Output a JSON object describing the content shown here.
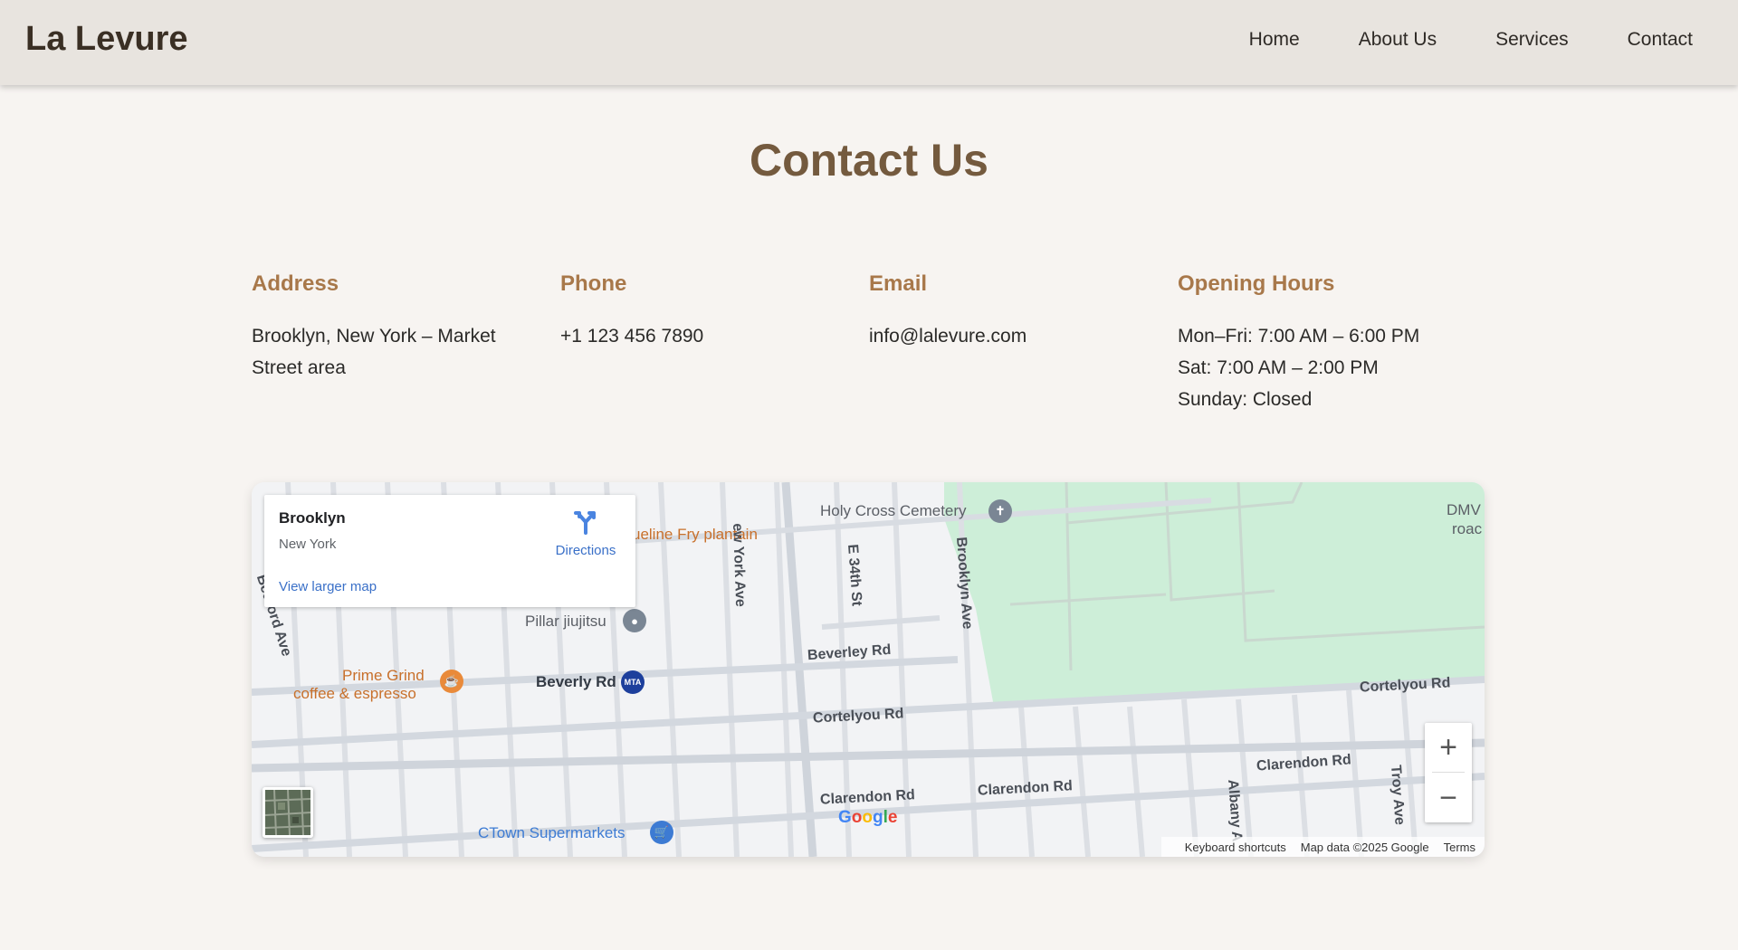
{
  "header": {
    "logo": "La Levure",
    "nav": [
      "Home",
      "About Us",
      "Services",
      "Contact"
    ]
  },
  "title": "Contact Us",
  "info": {
    "address": {
      "heading": "Address",
      "lines": [
        "Brooklyn, New York – Market",
        "Street area"
      ]
    },
    "phone": {
      "heading": "Phone",
      "lines": [
        "+1 123 456 7890"
      ]
    },
    "email": {
      "heading": "Email",
      "lines": [
        "info@lalevure.com"
      ]
    },
    "hours": {
      "heading": "Opening Hours",
      "lines": [
        "Mon–Fri: 7:00 AM – 6:00 PM",
        "Sat: 7:00 AM – 2:00 PM",
        "Sunday: Closed"
      ]
    }
  },
  "map": {
    "card": {
      "place": "Brooklyn",
      "sub": "New York",
      "directions": "Directions",
      "larger": "View larger map"
    },
    "labels": {
      "cemetery": "Holy Cross Cemetery",
      "dmv": "DMV",
      "dmv2": "roac",
      "plantain": "ueline Fry plantain",
      "pillar": "Pillar jiujitsu",
      "prime1": "Prime Grind",
      "prime2": "coffee & espresso",
      "beverly": "Beverly Rd",
      "beverley": "Beverley Rd",
      "cortelyou1": "Cortelyou Rd",
      "cortelyou2": "Cortelyou Rd",
      "clarendon1": "Clarendon Rd",
      "clarendon2": "Clarendon Rd",
      "clarendon3": "Clarendon Rd",
      "ctown": "CTown Supermarkets",
      "newyork": "ew York Ave",
      "e34": "E 34th St",
      "brooklynave": "Brooklyn Ave",
      "bedford": "Bedford Ave",
      "albany": "Albany A",
      "troy": "Troy Ave",
      "mta": "MTA"
    },
    "google": "Google",
    "footer": [
      "Keyboard shortcuts",
      "Map data ©2025 Google",
      "Terms"
    ],
    "colors": {
      "park": "#cdeed8",
      "road": "#d6dae1",
      "street": "#e3e6ea"
    }
  }
}
